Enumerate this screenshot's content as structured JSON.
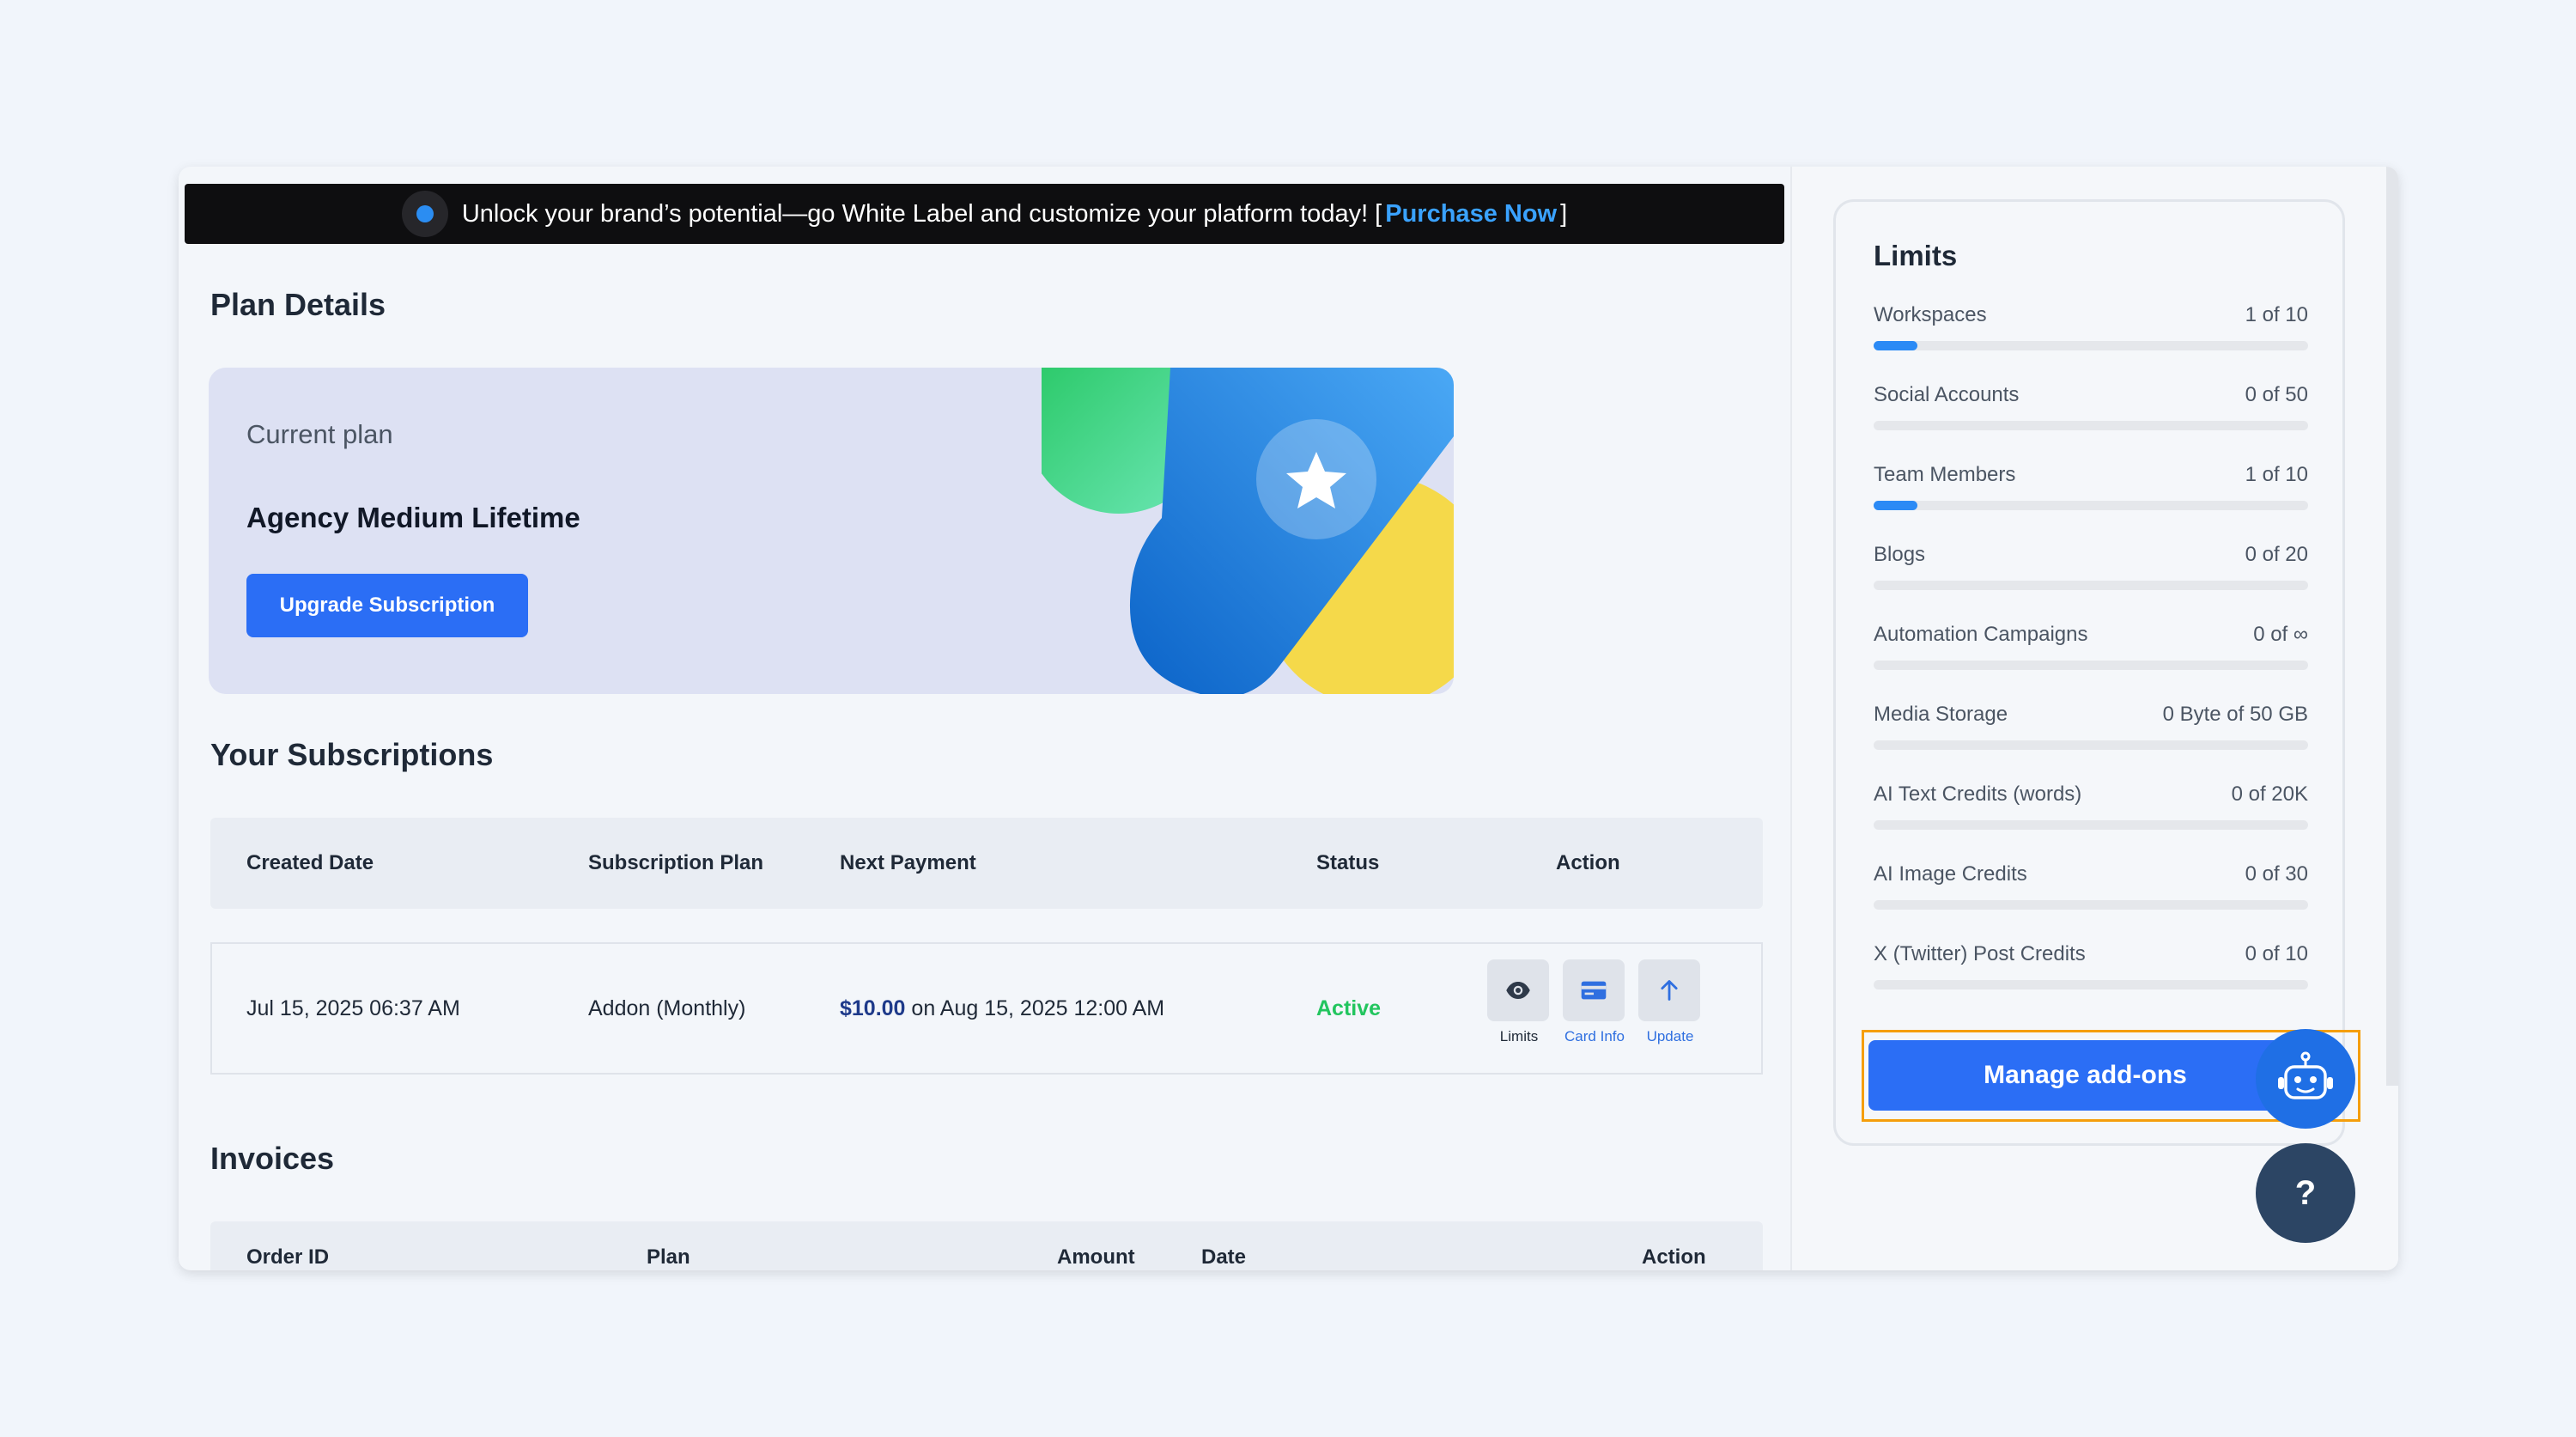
{
  "banner": {
    "text": "Unlock your brand’s potential—go White Label and customize your platform today! [",
    "link": "Purchase Now",
    "close_bracket": "]"
  },
  "plan": {
    "section_title": "Plan Details",
    "current_label": "Current plan",
    "name": "Agency Medium Lifetime",
    "upgrade_label": "Upgrade Subscription"
  },
  "subscriptions": {
    "section_title": "Your Subscriptions",
    "headers": [
      "Created Date",
      "Subscription Plan",
      "Next Payment",
      "Status",
      "Action"
    ],
    "rows": [
      {
        "created": "Jul 15, 2025 06:37 AM",
        "plan": "Addon (Monthly)",
        "amount": "$10.00",
        "next_payment_rest": "on Aug 15, 2025 12:00 AM",
        "status": "Active",
        "actions": [
          {
            "label": "Limits",
            "icon": "eye-icon"
          },
          {
            "label": "Card Info",
            "icon": "card-icon"
          },
          {
            "label": "Update",
            "icon": "arrow-up-icon"
          }
        ]
      }
    ]
  },
  "invoices": {
    "section_title": "Invoices",
    "headers": [
      "Order ID",
      "Plan",
      "Amount",
      "Date",
      "Action"
    ]
  },
  "limits": {
    "title": "Limits",
    "items": [
      {
        "name": "Workspaces",
        "value": "1 of 10",
        "fraction": 0.1
      },
      {
        "name": "Social Accounts",
        "value": "0 of 50",
        "fraction": 0
      },
      {
        "name": "Team Members",
        "value": "1 of 10",
        "fraction": 0.1
      },
      {
        "name": "Blogs",
        "value": "0 of 20",
        "fraction": 0
      },
      {
        "name": "Automation Campaigns",
        "value": "0 of ∞",
        "fraction": 0
      },
      {
        "name": "Media Storage",
        "value": "0 Byte of 50 GB",
        "fraction": 0
      },
      {
        "name": "AI Text Credits (words)",
        "value": "0 of 20K",
        "fraction": 0
      },
      {
        "name": "AI Image Credits",
        "value": "0 of 30",
        "fraction": 0
      },
      {
        "name": "X (Twitter) Post Credits",
        "value": "0 of 10",
        "fraction": 0
      }
    ],
    "manage_label": "Manage add-ons"
  },
  "help_fab": {
    "label": "?"
  },
  "colors": {
    "accent": "#2b6ef5",
    "active": "#22c55e",
    "progress": "#2b8af5",
    "banner_bg": "#0e0e10",
    "highlight": "#f59e0b"
  }
}
